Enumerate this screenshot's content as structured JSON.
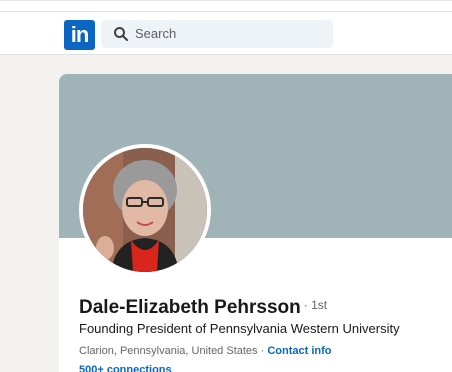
{
  "header": {
    "logo_text": "in",
    "search_placeholder": "Search"
  },
  "profile": {
    "name": "Dale-Elizabeth Pehrsson",
    "degree": "· 1st",
    "headline": "Founding President of Pennsylvania Western University",
    "location": "Clarion, Pennsylvania, United States ·",
    "contact_label": "Contact info",
    "connections": "500+ connections"
  },
  "colors": {
    "brand": "#0a66c2",
    "banner": "#a0b4b7"
  }
}
